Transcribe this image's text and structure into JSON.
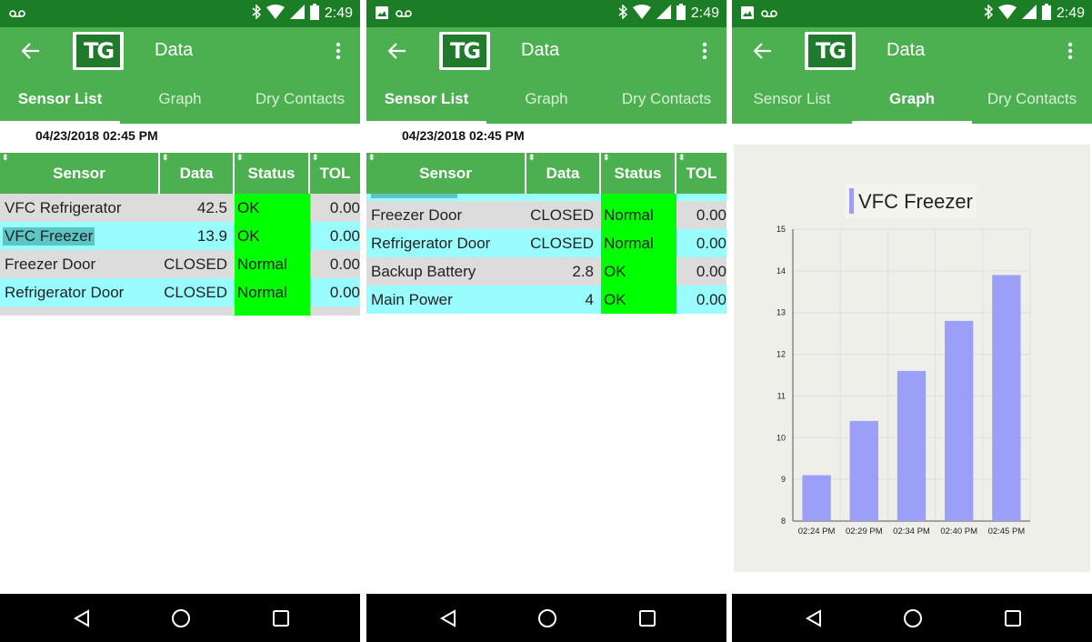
{
  "status_bar": {
    "time": "2:49",
    "icons": [
      "voicemail-icon",
      "image-icon",
      "bluetooth-icon",
      "wifi-icon",
      "signal-icon",
      "battery-icon"
    ]
  },
  "app_bar": {
    "title": "Data",
    "logo_text": "TG"
  },
  "tabs": [
    {
      "label": "Sensor List"
    },
    {
      "label": "Graph"
    },
    {
      "label": "Dry Contacts"
    }
  ],
  "timestamp": "04/23/2018 02:45 PM",
  "table": {
    "columns": [
      "Sensor",
      "Data",
      "Status",
      "TOL"
    ],
    "sort_glyph": "⬍",
    "screen1_rows": [
      {
        "sensor": "VFC Refrigerator",
        "data": "42.5",
        "status": "OK",
        "tol": "0.00"
      },
      {
        "sensor": "VFC Freezer",
        "data": "13.9",
        "status": "OK",
        "tol": "0.00"
      },
      {
        "sensor": "Freezer  Door",
        "data": "CLOSED",
        "status": "Normal",
        "tol": "0.00"
      },
      {
        "sensor": "Refrigerator  Door",
        "data": "CLOSED",
        "status": "Normal",
        "tol": "0.00"
      }
    ],
    "screen2_rows": [
      {
        "sensor": "Freezer  Door",
        "data": "CLOSED",
        "status": "Normal",
        "tol": "0.00"
      },
      {
        "sensor": "Refrigerator  Door",
        "data": "CLOSED",
        "status": "Normal",
        "tol": "0.00"
      },
      {
        "sensor": "Backup Battery",
        "data": "2.8",
        "status": "OK",
        "tol": "0.00"
      },
      {
        "sensor": "Main Power",
        "data": "4",
        "status": "OK",
        "tol": "0.00"
      }
    ]
  },
  "colors": {
    "status_bar": "#1b7e26",
    "app_bar": "#4caf50",
    "row_gray": "#dcdcdc",
    "row_cyan": "#99fdfd",
    "status_green": "#00ff00",
    "bar": "#9b9ff7",
    "chart_bg": "#efefe9"
  },
  "chart_data": {
    "type": "bar",
    "title": "VFC Freezer",
    "categories": [
      "02:24 PM",
      "02:29 PM",
      "02:34 PM",
      "02:40 PM",
      "02:45 PM"
    ],
    "series": [
      {
        "name": "VFC Freezer",
        "values": [
          9.1,
          10.4,
          11.6,
          12.8,
          13.9
        ]
      }
    ],
    "ylim": [
      8,
      15
    ],
    "yticks": [
      8,
      9,
      10,
      11,
      12,
      13,
      14,
      15
    ],
    "grid": true,
    "legend": "top-center"
  }
}
